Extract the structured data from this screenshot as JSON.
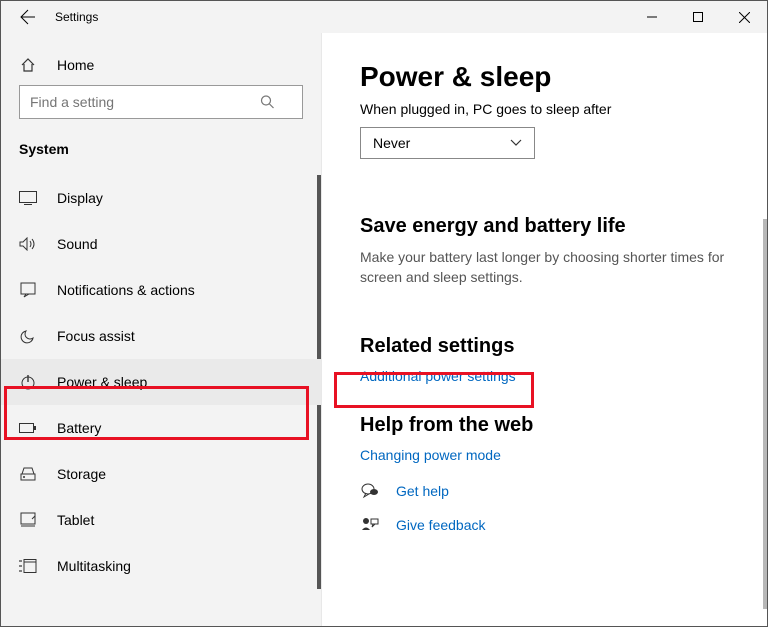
{
  "titlebar": {
    "title": "Settings"
  },
  "sidebar": {
    "home": "Home",
    "search_placeholder": "Find a setting",
    "heading": "System",
    "items": [
      {
        "icon": "display",
        "label": "Display"
      },
      {
        "icon": "sound",
        "label": "Sound"
      },
      {
        "icon": "notifications",
        "label": "Notifications & actions"
      },
      {
        "icon": "focus",
        "label": "Focus assist"
      },
      {
        "icon": "power",
        "label": "Power & sleep"
      },
      {
        "icon": "battery",
        "label": "Battery"
      },
      {
        "icon": "storage",
        "label": "Storage"
      },
      {
        "icon": "tablet",
        "label": "Tablet"
      },
      {
        "icon": "multitasking",
        "label": "Multitasking"
      }
    ],
    "selected_index": 4
  },
  "main": {
    "title": "Power & sleep",
    "plugged_label": "When plugged in, PC goes to sleep after",
    "select_value": "Never",
    "energy_heading": "Save energy and battery life",
    "energy_body": "Make your battery last longer by choosing shorter times for screen and sleep settings.",
    "related_heading": "Related settings",
    "related_link": "Additional power settings",
    "help_heading": "Help from the web",
    "help_link": "Changing power mode",
    "get_help": "Get help",
    "give_feedback": "Give feedback"
  }
}
